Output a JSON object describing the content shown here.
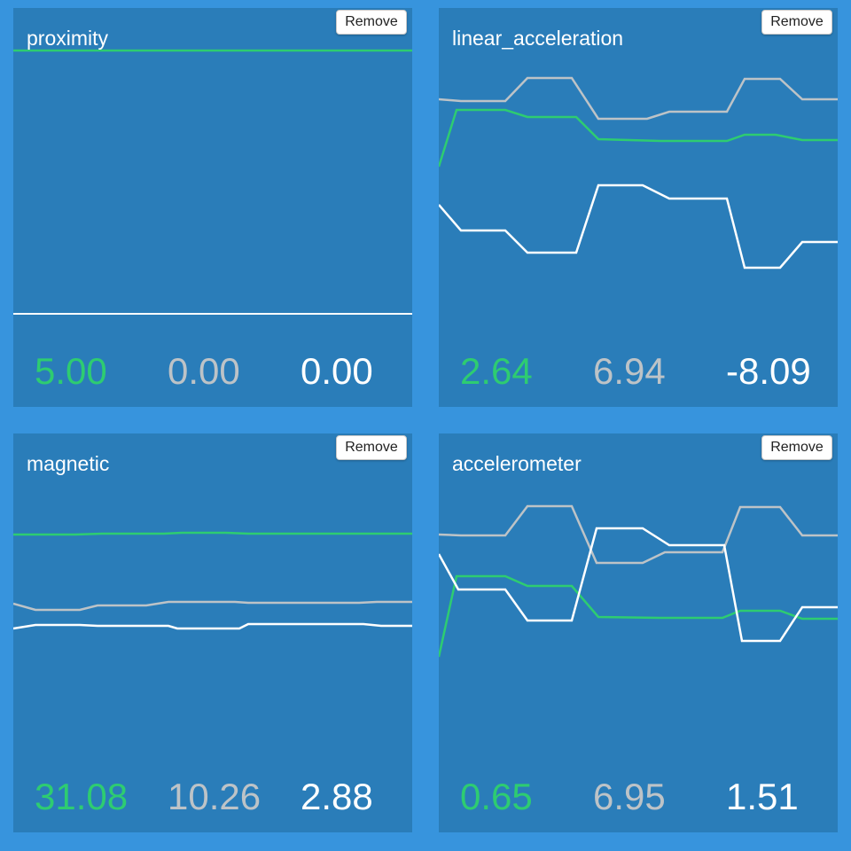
{
  "colors": {
    "background": "#3794DD",
    "card": "#2A7DB9",
    "series": [
      "#2ECC71",
      "#BDC3C7",
      "#FFFFFF"
    ]
  },
  "remove_label": "Remove",
  "cards": [
    {
      "title": "proximity",
      "values": [
        "5.00",
        "0.00",
        "0.00"
      ]
    },
    {
      "title": "linear_acceleration",
      "values": [
        "2.64",
        "6.94",
        "-8.09"
      ]
    },
    {
      "title": "magnetic",
      "values": [
        "31.08",
        "10.26",
        "2.88"
      ]
    },
    {
      "title": "accelerometer",
      "values": [
        "0.65",
        "6.95",
        "1.51"
      ]
    }
  ]
}
